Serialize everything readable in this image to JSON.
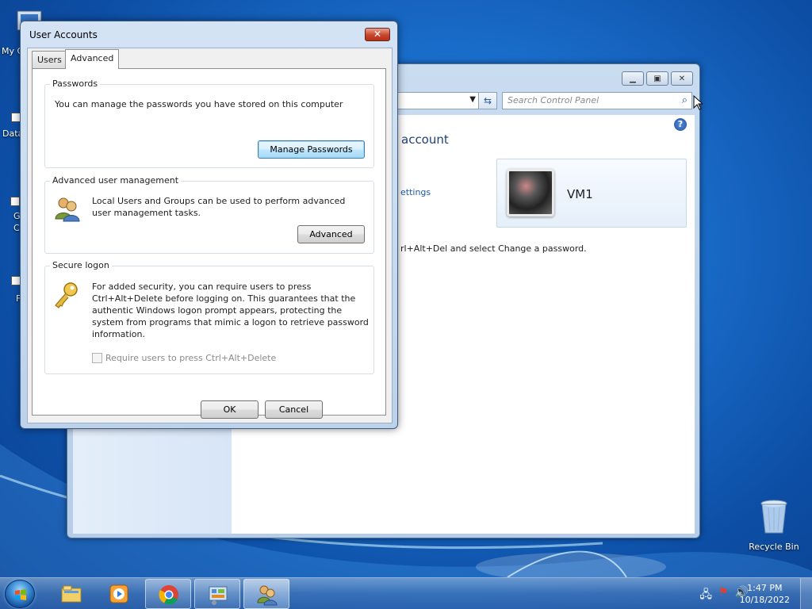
{
  "desktop": {
    "icons": [
      {
        "label": "My C",
        "name": "computer"
      },
      {
        "label": "Data",
        "name": "data"
      },
      {
        "label": "G",
        "name": "g"
      },
      {
        "label": "C",
        "name": "c"
      },
      {
        "label": "F",
        "name": "f"
      }
    ],
    "recycle_bin": "Recycle Bin"
  },
  "control_panel": {
    "search_placeholder": "Search Control Panel",
    "heading": "account",
    "settings_link": "ettings",
    "instruction": "rl+Alt+Del and select Change a password.",
    "username": "VM1",
    "help_icon": "?"
  },
  "dialog": {
    "title": "User Accounts",
    "close_label": "✕",
    "tabs": [
      {
        "label": "Users",
        "active": false
      },
      {
        "label": "Advanced",
        "active": true
      }
    ],
    "passwords": {
      "label": "Passwords",
      "text": "You can manage the passwords you have stored on this computer",
      "button": "Manage Passwords"
    },
    "advanced_mgmt": {
      "label": "Advanced user management",
      "text": "Local Users and Groups can be used to perform advanced user management tasks.",
      "button": "Advanced"
    },
    "secure_logon": {
      "label": "Secure logon",
      "text": "For added security, you can require users to press Ctrl+Alt+Delete before logging on. This guarantees that the authentic Windows logon prompt appears, protecting the system from programs that mimic a logon to retrieve password information.",
      "checkbox_label": "Require users to press Ctrl+Alt+Delete",
      "checkbox_checked": false
    },
    "ok": "OK",
    "cancel": "Cancel"
  },
  "taskbar": {
    "time": "1:47 PM",
    "date": "10/18/2022",
    "items": [
      "file-explorer",
      "media-player",
      "chrome",
      "control-panel",
      "user-accounts"
    ]
  }
}
